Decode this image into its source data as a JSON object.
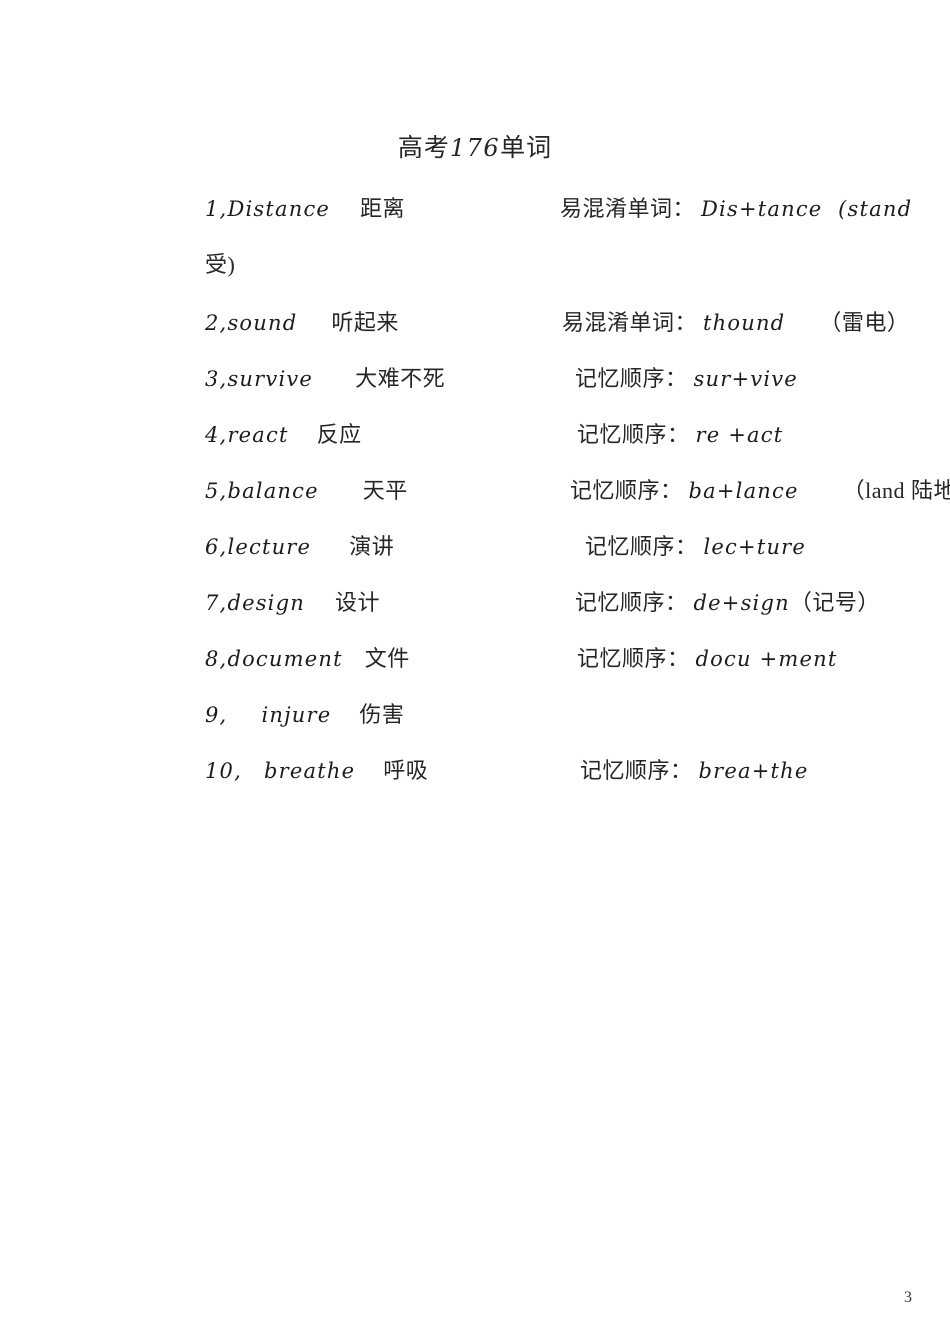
{
  "document": {
    "title_prefix": "高考",
    "title_number": "176",
    "title_suffix": "单词",
    "page_number": "3"
  },
  "entries": [
    {
      "index": "1,",
      "word": "Distance",
      "meaning": "距离",
      "note_label": "易混淆单词：",
      "note_value": "Dis+tance  (stand",
      "continuation": "受)"
    },
    {
      "index": "2,",
      "word": "sound",
      "meaning": "听起来",
      "note_label": "易混淆单词：",
      "note_value": "thound",
      "note_extra": "（雷电）",
      "continuation": ""
    },
    {
      "index": "3,",
      "word": "survive",
      "meaning": "大难不死",
      "note_label": "记忆顺序：",
      "note_value": "sur+vive",
      "continuation": ""
    },
    {
      "index": "4,",
      "word": "react",
      "meaning": "反应",
      "note_label": "记忆顺序：",
      "note_value": "re +act",
      "continuation": ""
    },
    {
      "index": "5,",
      "word": "balance",
      "meaning": "天平",
      "note_label": "记忆顺序：",
      "note_value": "ba+lance",
      "note_extra": "（land 陆地",
      "continuation": ""
    },
    {
      "index": "6,",
      "word": "lecture",
      "meaning": "演讲",
      "note_label": "记忆顺序：",
      "note_value": "lec+ture",
      "continuation": ""
    },
    {
      "index": "7,",
      "word": "design",
      "meaning": "设计",
      "note_label": "记忆顺序：",
      "note_value": "de+sign",
      "note_extra": "（记号）",
      "continuation": ""
    },
    {
      "index": "8,",
      "word": "document",
      "meaning": "文件",
      "note_label": "记忆顺序：",
      "note_value": "docu +ment",
      "continuation": ""
    },
    {
      "index": "9,",
      "word": "injure",
      "meaning": "伤害",
      "note_label": "",
      "note_value": "",
      "continuation": ""
    },
    {
      "index": "10,",
      "word": "breathe",
      "meaning": "呼吸",
      "note_label": "记忆顺序：",
      "note_value": "brea+the",
      "continuation": ""
    }
  ]
}
